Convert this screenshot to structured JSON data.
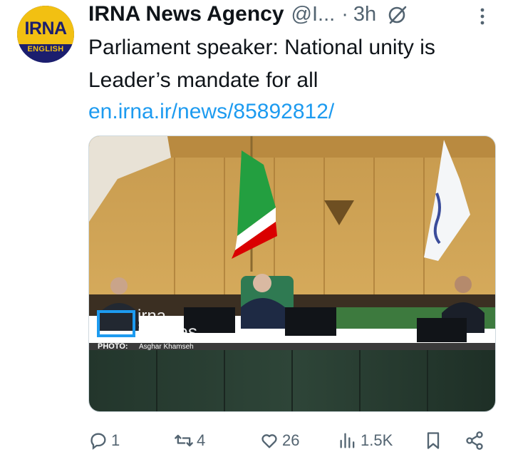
{
  "account": {
    "avatar_brand": "IRNA",
    "avatar_sub": "ENGLISH",
    "display_name": "IRNA News Agency",
    "handle": "@I...",
    "separator": "·",
    "time": "3h"
  },
  "tweet": {
    "text": "Parliament speaker: National unity is Leader’s mandate for all",
    "link": "en.irna.ir/news/85892812/"
  },
  "media": {
    "watermark_brand": "irna",
    "watermark_sub": "images",
    "photo_credit_label": "PHOTO:",
    "photo_credit_name": "Asghar Khamseh"
  },
  "actions": {
    "replies": "1",
    "reposts": "4",
    "likes": "26",
    "views": "1.5K"
  },
  "icons": [
    "grok-icon",
    "more-icon",
    "reply-icon",
    "repost-icon",
    "like-icon",
    "views-icon",
    "bookmark-icon",
    "share-icon"
  ],
  "colors": {
    "link": "#1d9bf0",
    "secondary_text": "#536471",
    "avatar_navy": "#1b1e6e",
    "avatar_yellow": "#f2c012"
  }
}
